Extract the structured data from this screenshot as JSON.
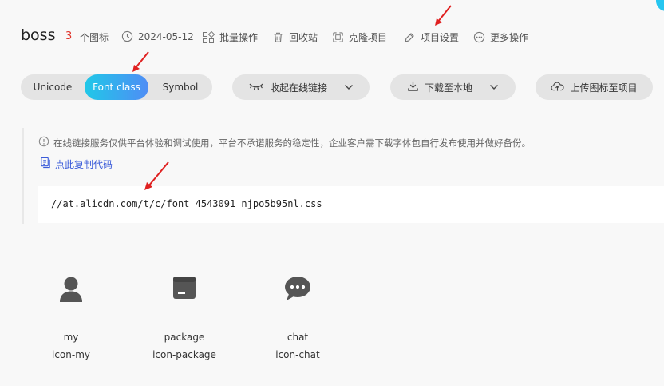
{
  "project": {
    "name": "boss",
    "icon_count": "3",
    "icon_count_label": "个图标",
    "date": "2024-05-12"
  },
  "header_actions": [
    {
      "label": "批量操作",
      "icon": "batch-icon"
    },
    {
      "label": "回收站",
      "icon": "trash-icon"
    },
    {
      "label": "克隆项目",
      "icon": "clone-icon"
    },
    {
      "label": "项目设置",
      "icon": "settings-icon"
    },
    {
      "label": "更多操作",
      "icon": "more-icon"
    }
  ],
  "tabs": {
    "unicode": "Unicode",
    "font_class": "Font class",
    "symbol": "Symbol",
    "active": "Font class"
  },
  "buttons": {
    "collapse_link": "收起在线链接",
    "download": "下载至本地",
    "upload": "上传图标至项目"
  },
  "notice": {
    "tip": "在线链接服务仅供平台体验和调试使用，平台不承诺服务的稳定性，企业客户需下载字体包自行发布使用并做好备份。",
    "copy_code": "点此复制代码",
    "css_url": "//at.alicdn.com/t/c/font_4543091_njpo5b95nl.css"
  },
  "icons": [
    {
      "name": "my",
      "class": "icon-my",
      "icon": "user-icon"
    },
    {
      "name": "package",
      "class": "icon-package",
      "icon": "package-icon"
    },
    {
      "name": "chat",
      "class": "icon-chat",
      "icon": "chat-icon"
    }
  ],
  "colors": {
    "accent_red": "#e0332a",
    "link_blue": "#3a5bd9",
    "active_gradient_start": "#20c8e8",
    "active_gradient_end": "#4f8df5",
    "annotation_arrow": "#e02020"
  }
}
